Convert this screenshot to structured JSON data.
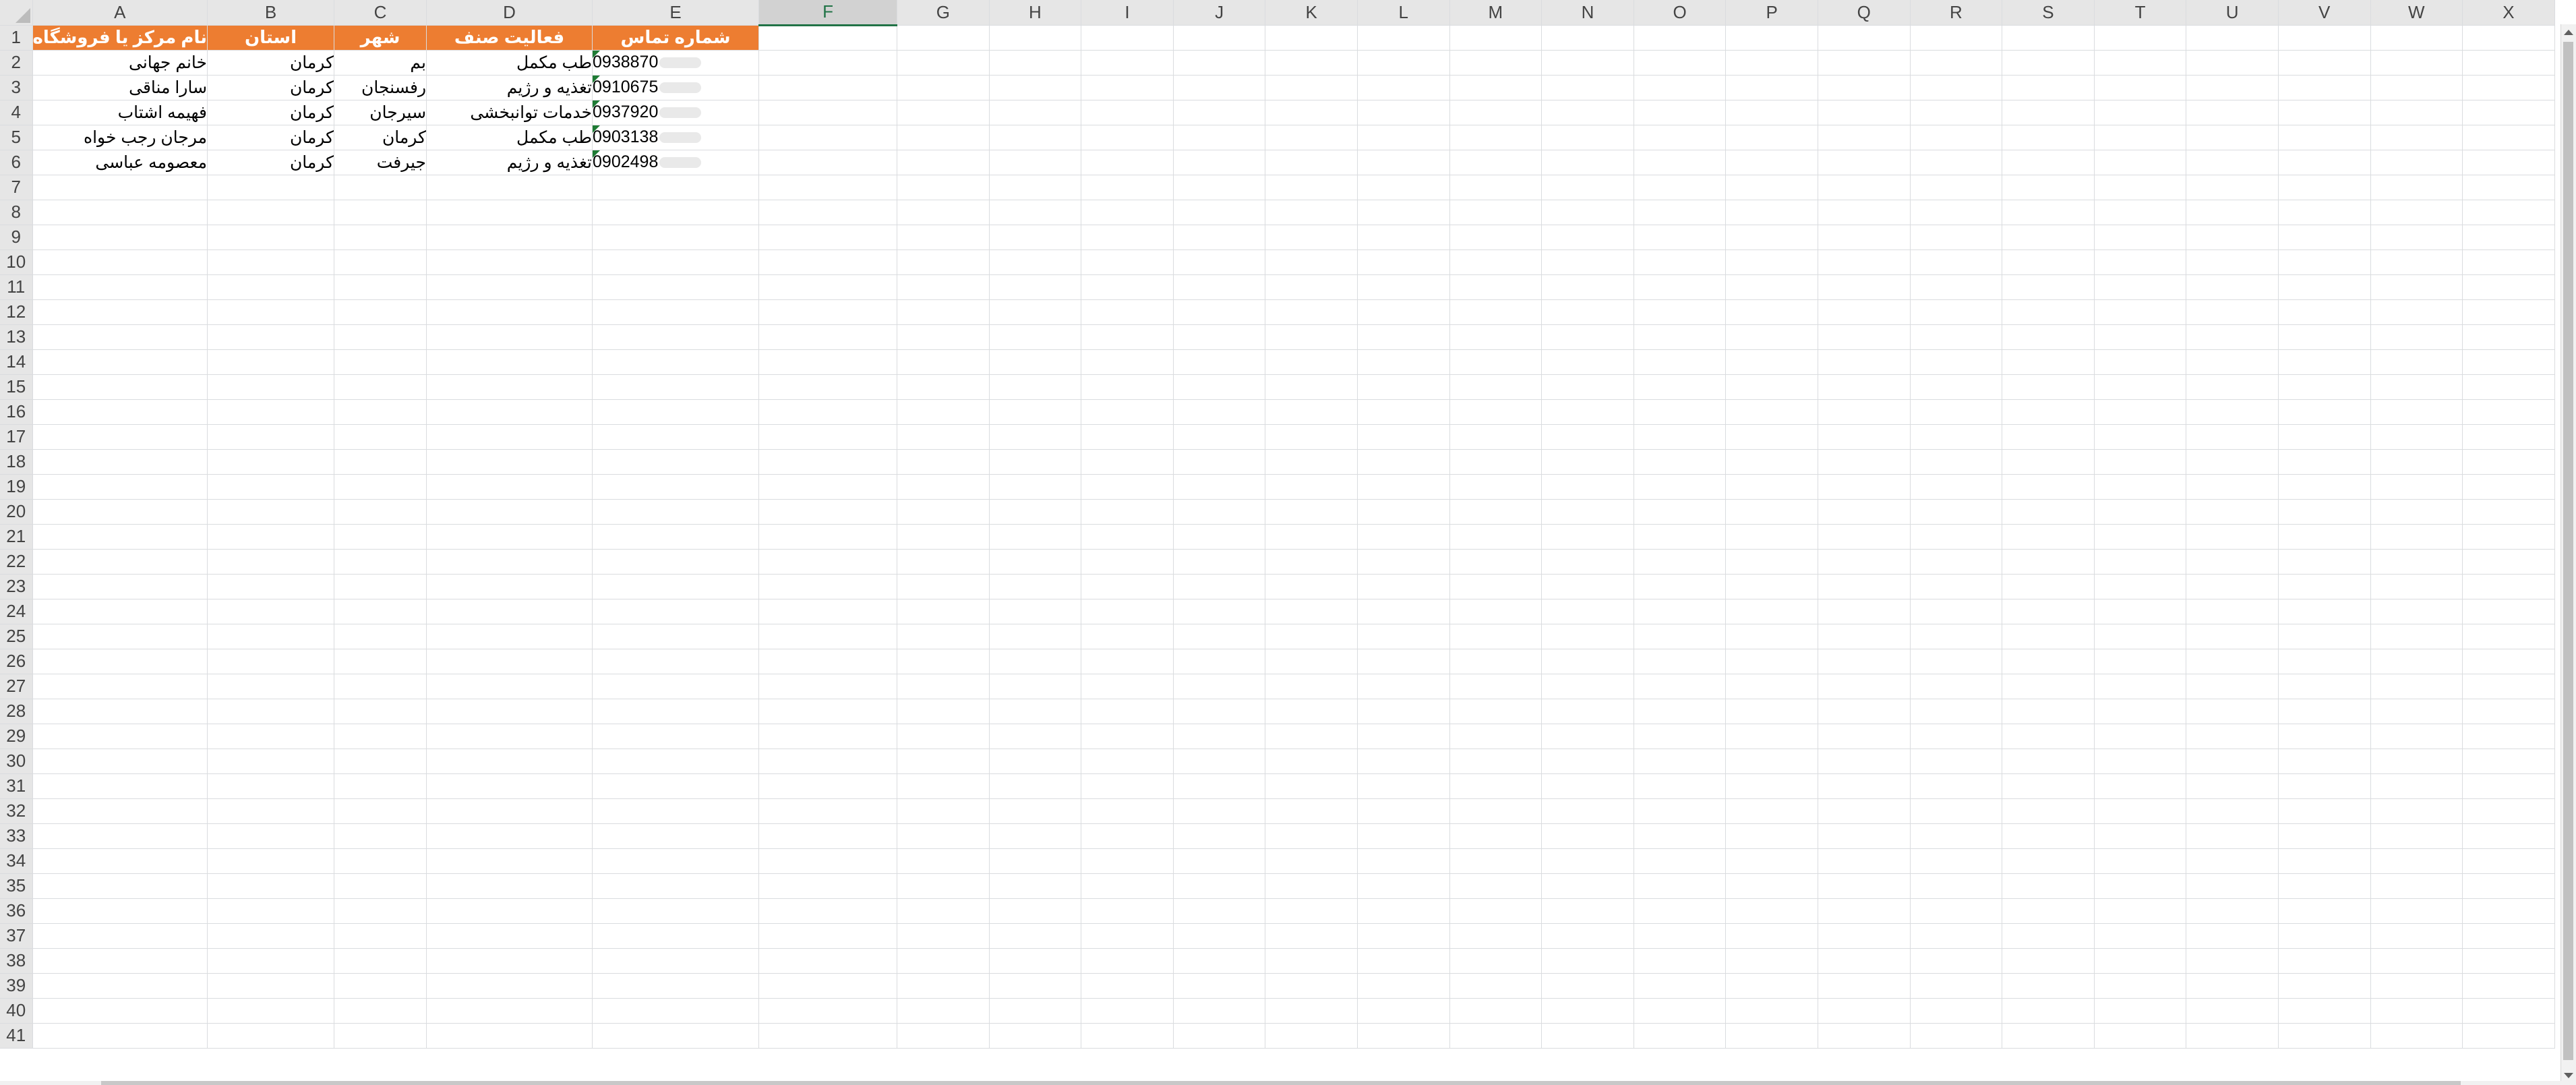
{
  "columns": [
    "A",
    "B",
    "C",
    "D",
    "E",
    "F",
    "G",
    "H",
    "I",
    "J",
    "K",
    "L",
    "M",
    "N",
    "O",
    "P",
    "Q",
    "R",
    "S",
    "T",
    "U",
    "V",
    "W",
    "X"
  ],
  "selected_column": "F",
  "header_row": {
    "A": "نام مرکز یا فروشگاه",
    "B": "استان",
    "C": "شهر",
    "D": "فعالیت صنف",
    "E": "شماره تماس"
  },
  "rows": [
    {
      "A": "خانم جهانی",
      "B": "کرمان",
      "C": "بم",
      "D": "طب مکمل",
      "E": "0938870"
    },
    {
      "A": "سارا مناقی",
      "B": "کرمان",
      "C": "رفسنجان",
      "D": "تغذیه و رژیم",
      "E": "0910675"
    },
    {
      "A": "فهیمه اشتاب",
      "B": "کرمان",
      "C": "سیرجان",
      "D": "خدمات توانبخشی",
      "E": "0937920"
    },
    {
      "A": "مرجان رجب خواه",
      "B": "کرمان",
      "C": "کرمان",
      "D": "طب مکمل",
      "E": "0903138"
    },
    {
      "A": "معصومه عباسی",
      "B": "کرمان",
      "C": "جیرفت",
      "D": "تغذیه و رژیم",
      "E": "0902498"
    }
  ],
  "total_rows": 41,
  "colors": {
    "header_fill": "#ed7d31",
    "header_text": "#ffffff",
    "selection_accent": "#217346",
    "error_flag": "#1e7b34"
  },
  "icons": {
    "corner": "select-all-triangle-icon",
    "flag": "number-stored-as-text-indicator-icon"
  }
}
